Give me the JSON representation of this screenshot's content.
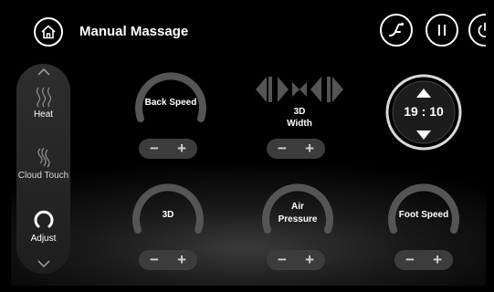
{
  "header": {
    "title": "Manual Massage"
  },
  "sidebar": {
    "items": [
      {
        "label": "Heat"
      },
      {
        "label": "Cloud Touch"
      },
      {
        "label": "Adjust"
      }
    ]
  },
  "controls": {
    "back_speed": {
      "label": "Back Speed"
    },
    "width_3d": {
      "line1": "3D",
      "line2": "Width"
    },
    "three_d": {
      "label": "3D"
    },
    "air_pressure": {
      "line1": "Air",
      "line2": "Pressure"
    },
    "foot_speed": {
      "label": "Foot Speed"
    },
    "minus": "−",
    "plus": "+"
  },
  "timer": {
    "value": "19 : 10"
  },
  "icons": [
    "home-icon",
    "recline-icon",
    "pause-icon",
    "power-icon",
    "chevron-up-icon",
    "chevron-down-icon",
    "heat-icon",
    "cloud-touch-icon",
    "adjust-icon",
    "triangle-up-icon",
    "triangle-down-icon",
    "width-arrows-icon"
  ],
  "colors": {
    "background": "#000000",
    "panel": "#2a2a2a",
    "button": "#3c3c3c",
    "text": "#ffffff"
  }
}
